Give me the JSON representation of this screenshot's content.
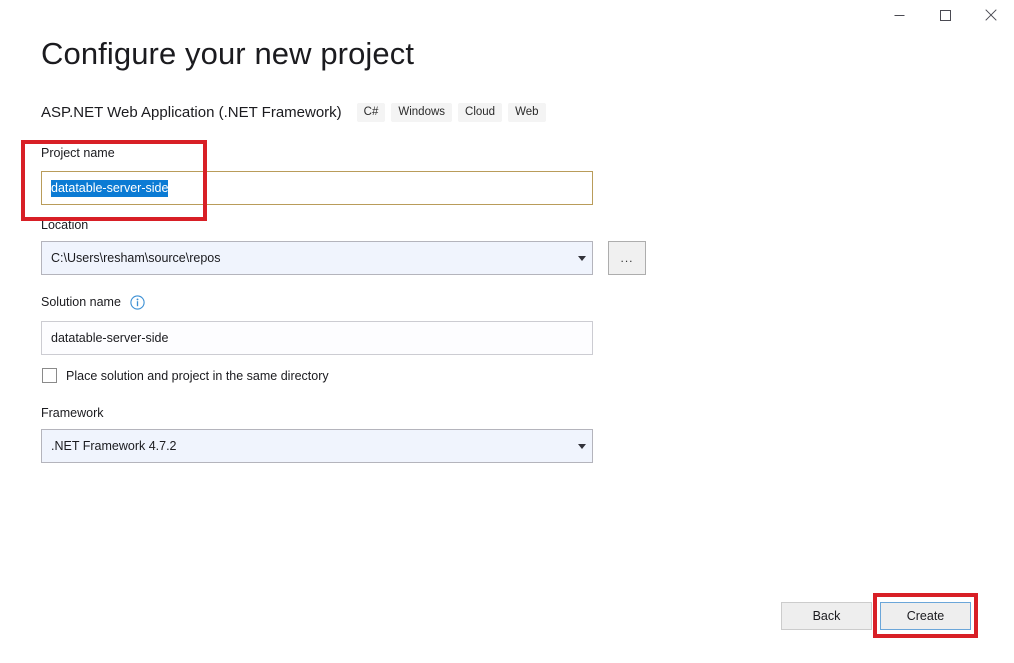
{
  "window": {
    "controls": [
      {
        "name": "minimize-button",
        "icon": "minimize-icon",
        "label": "–"
      },
      {
        "name": "maximize-button",
        "icon": "maximize-icon",
        "label": "□"
      },
      {
        "name": "close-button",
        "icon": "close-icon",
        "label": "✕"
      }
    ]
  },
  "header": {
    "title": "Configure your new project",
    "subtitle": "ASP.NET Web Application (.NET Framework)",
    "tags": [
      "C#",
      "Windows",
      "Cloud",
      "Web"
    ]
  },
  "form": {
    "project_name": {
      "label": "Project name",
      "value": "datatable-server-side",
      "selected": true
    },
    "location": {
      "label": "Location",
      "value": "C:\\Users\\resham\\source\\repos",
      "browse_label": "..."
    },
    "solution_name": {
      "label": "Solution name",
      "info_icon": "info-icon",
      "value": "datatable-server-side"
    },
    "same_directory": {
      "label": "Place solution and project in the same directory",
      "checked": false
    },
    "framework": {
      "label": "Framework",
      "value": ".NET Framework 4.7.2"
    }
  },
  "footer": {
    "back_label": "Back",
    "create_label": "Create"
  },
  "annotations": {
    "accent_color": "#d81f26",
    "selection_color": "#0b7bd4",
    "focus_border_color": "#b99c5a"
  }
}
